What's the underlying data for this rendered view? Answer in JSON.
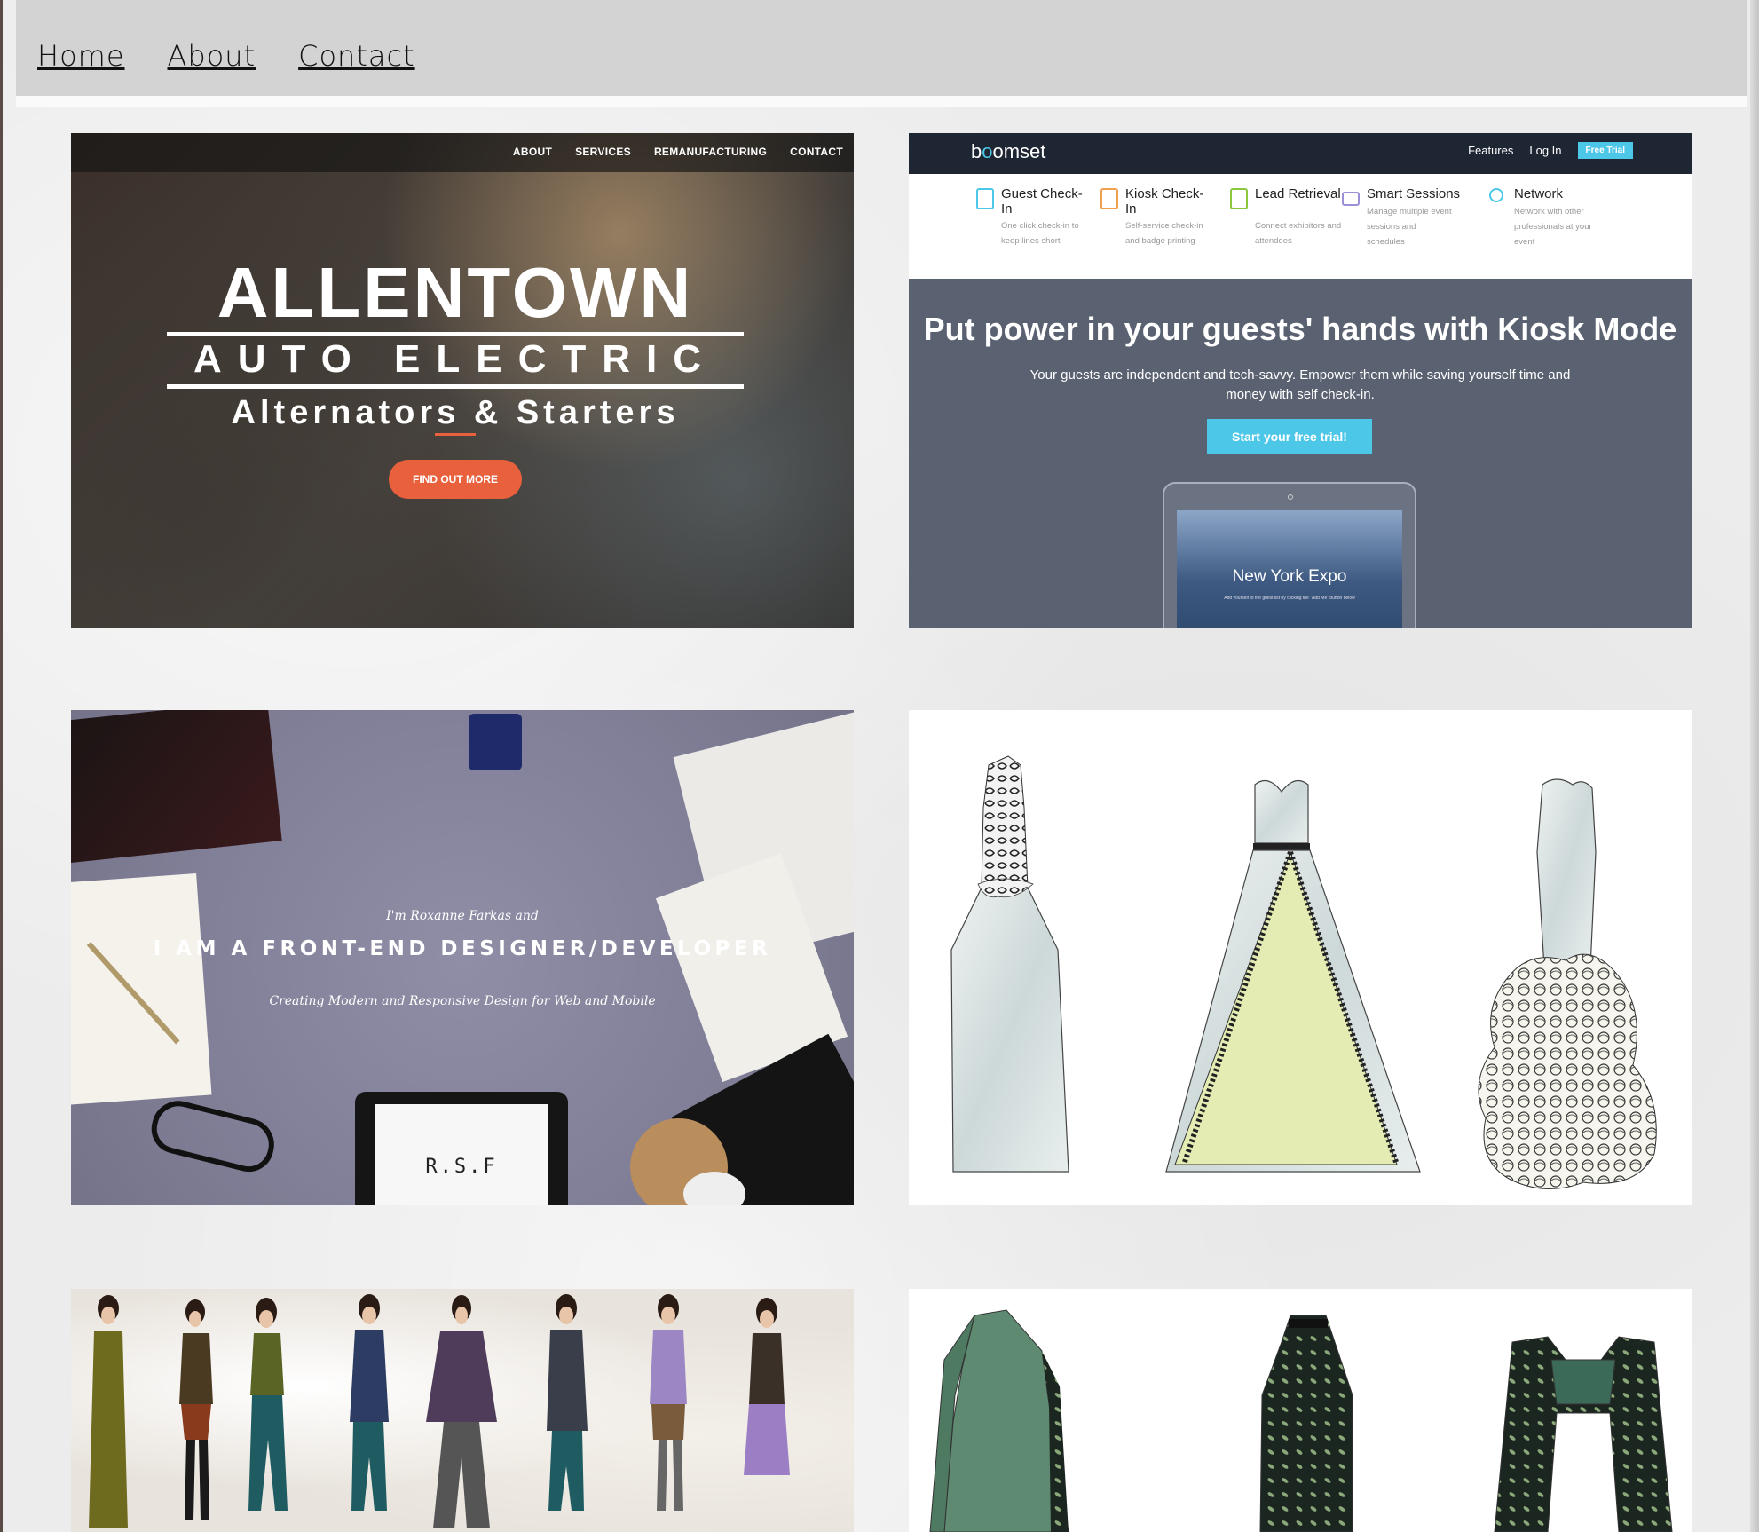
{
  "nav": {
    "links": [
      "Home",
      "About",
      "Contact"
    ]
  },
  "tiles": {
    "allentown": {
      "menu": [
        "ABOUT",
        "SERVICES",
        "REMANUFACTURING",
        "CONTACT"
      ],
      "line1": "ALLENTOWN",
      "line2": "AUTO ELECTRIC",
      "line3": "Alternators & Starters",
      "button": "FIND OUT MORE",
      "accent": "#e8603c"
    },
    "boomset": {
      "logo_pre": "b",
      "logo_o": "o",
      "logo_post": "omset",
      "nav": [
        "Features",
        "Log In"
      ],
      "trial_button": "Free Trial",
      "features": [
        {
          "title": "Guest Check-In",
          "desc": "One click check-in to keep lines short",
          "icon": "tablet-icon"
        },
        {
          "title": "Kiosk Check-In",
          "desc": "Self-service check-in and badge printing",
          "icon": "kiosk-icon"
        },
        {
          "title": "Lead Retrieval",
          "desc": "Connect exhibitors and attendees",
          "icon": "phone-icon"
        },
        {
          "title": "Smart Sessions",
          "desc": "Manage multiple event sessions and schedules",
          "icon": "chart-icon"
        },
        {
          "title": "Network",
          "desc": "Network with other professionals at your event",
          "icon": "network-icon"
        }
      ],
      "headline": "Put power in your guests' hands with Kiosk Mode",
      "subline": "Your guests are independent and tech-savvy. Empower them while saving yourself time and money with self check-in.",
      "cta": "Start your free trial!",
      "tablet_title": "New York Expo",
      "tablet_small": "Add yourself to the guest list by clicking the \"Add Me\" button below",
      "accent": "#4dc7e8"
    },
    "roxanne": {
      "intro": "I'm Roxanne Farkas and",
      "title": "I AM A FRONT-END DESIGNER/DEVELOPER",
      "tagline": "Creating Modern and Responsive Design for Web and Mobile",
      "tablet_text": "R.S.F"
    }
  }
}
